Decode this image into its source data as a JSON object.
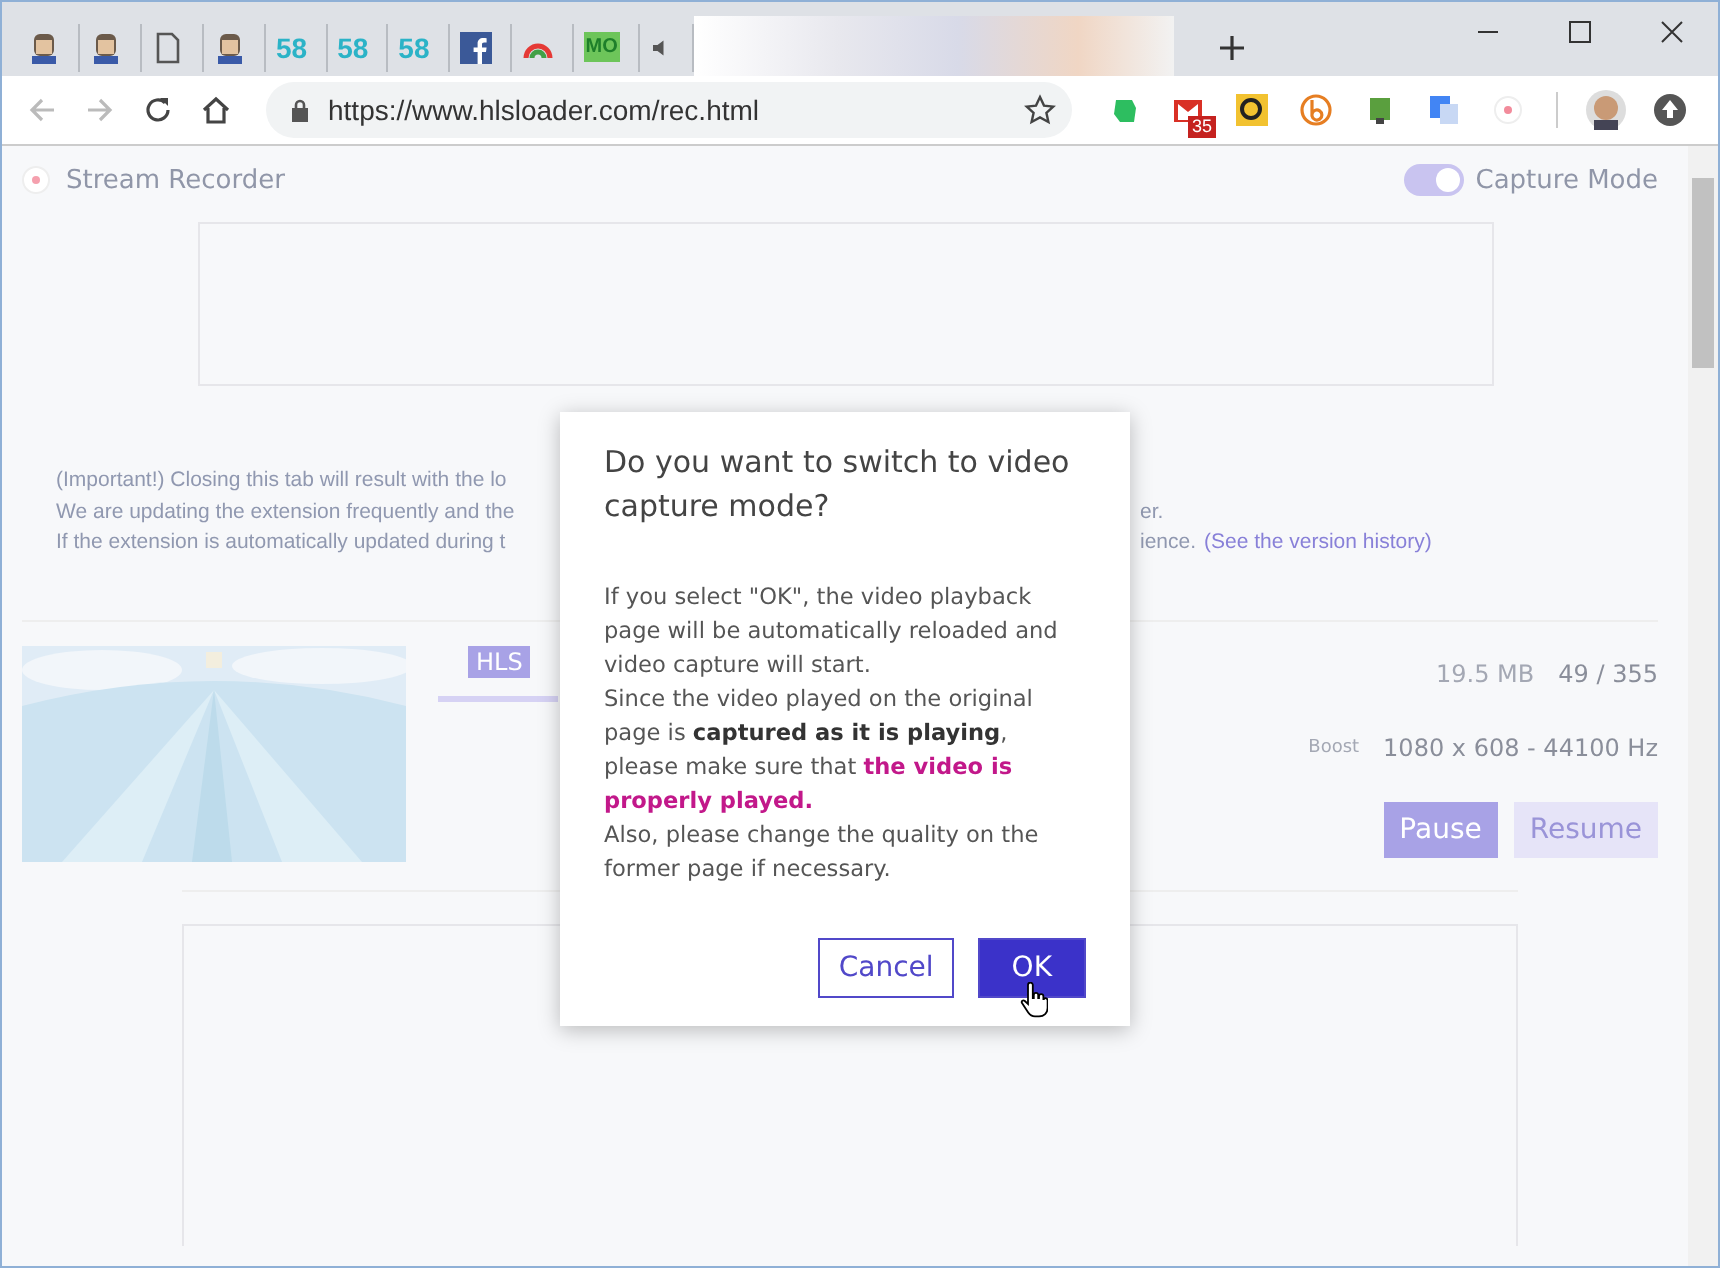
{
  "tabs": [
    {
      "kind": "avatar"
    },
    {
      "kind": "avatar"
    },
    {
      "kind": "page"
    },
    {
      "kind": "avatar"
    },
    {
      "kind": "number",
      "label": "58"
    },
    {
      "kind": "number",
      "label": "58"
    },
    {
      "kind": "number",
      "label": "58"
    },
    {
      "kind": "facebook"
    },
    {
      "kind": "drive"
    },
    {
      "kind": "mo",
      "label": "MO"
    },
    {
      "kind": "audio"
    }
  ],
  "address": {
    "url": "https://www.hlsloader.com/rec.html"
  },
  "extensions": [
    {
      "kind": "evernote"
    },
    {
      "kind": "gmail",
      "badge": "35"
    },
    {
      "kind": "search"
    },
    {
      "kind": "b"
    },
    {
      "kind": "green"
    },
    {
      "kind": "translate"
    },
    {
      "kind": "record"
    }
  ],
  "app": {
    "title": "Stream Recorder",
    "capture_mode": {
      "label": "Capture Mode",
      "on": true
    }
  },
  "notice": {
    "lines": [
      {
        "text": "(Important!) Closing this tab will result with the lo"
      },
      {
        "text": "We are updating the extension frequently and the",
        "tail": "er."
      },
      {
        "text": "If the extension is automatically updated during t",
        "tail": "ience."
      }
    ],
    "link": "(See the version history)"
  },
  "media": {
    "format": "HLS",
    "size": "19.5 MB",
    "segments": "49 / 355",
    "boost": "Boost",
    "resolution": "1080 x 608 - 44100 Hz",
    "buttons": [
      {
        "label": "Pause",
        "disabled": false
      },
      {
        "label": "Resume",
        "disabled": true
      }
    ]
  },
  "dialog": {
    "title": "Do you want to switch to video capture mode?",
    "paragraphs": [
      [
        {
          "kind": "plain",
          "text": "If you select \"OK\", the video playback page will be automatically reloaded and video capture will start."
        }
      ],
      [
        {
          "kind": "plain",
          "text": "Since the video played on the original page is "
        },
        {
          "kind": "strong",
          "text": "captured as it is playing"
        },
        {
          "kind": "plain",
          "text": ", please make sure that "
        },
        {
          "kind": "highlight",
          "text": "the video is properly played."
        }
      ],
      [
        {
          "kind": "plain",
          "text": "Also, please change the quality on the former page if necessary."
        }
      ]
    ],
    "buttons": [
      {
        "label": "Cancel",
        "kind": "secondary"
      },
      {
        "label": "OK",
        "kind": "primary"
      }
    ]
  }
}
